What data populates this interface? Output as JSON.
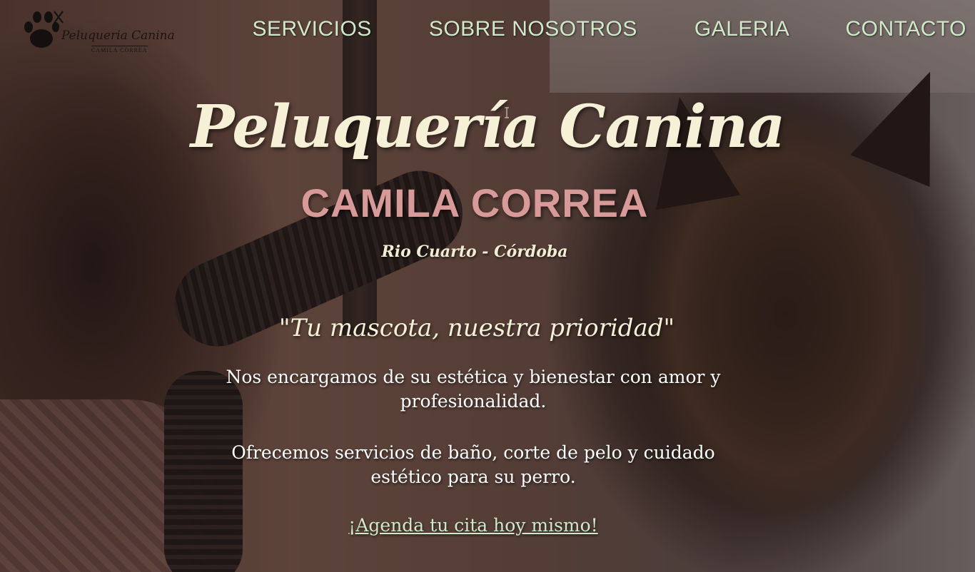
{
  "logo": {
    "title": "Peluqueria Canina",
    "subtitle": "CAMILA CORREA",
    "icon": "paw-scissors-icon"
  },
  "nav": {
    "items": [
      {
        "label": "SERVICIOS"
      },
      {
        "label": "SOBRE NOSOTROS"
      },
      {
        "label": "GALERIA"
      },
      {
        "label": "CONTACTO"
      }
    ]
  },
  "hero": {
    "title": "Peluquería Canina",
    "subtitle": "CAMILA CORREA",
    "location": "Rio Cuarto - Córdoba",
    "slogan": "\"Tu mascota, nuestra prioridad\"",
    "paragraph_1": "Nos encargamos de su estética y bienestar con amor y profesionalidad.",
    "paragraph_2": "Ofrecemos servicios de baño, corte de pelo y cuidado estético para su perro.",
    "cta": "¡Agenda tu cita hoy mismo!"
  },
  "colors": {
    "nav_text": "#cfe9c8",
    "title": "#f5f0d6",
    "subtitle": "#d79a98",
    "body_text": "#ffffff"
  }
}
